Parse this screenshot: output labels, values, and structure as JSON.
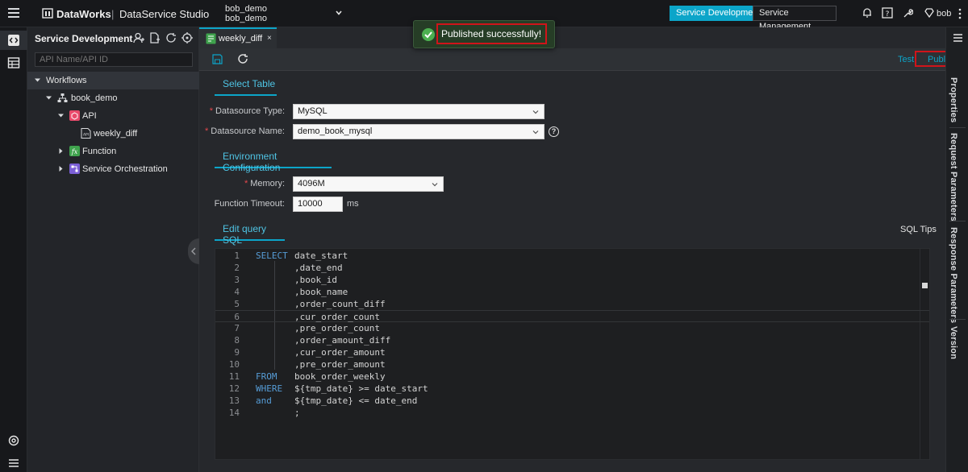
{
  "topbar": {
    "brand": "DataWorks",
    "separator": "|",
    "product": "DataService Studio",
    "workspace_line1": "bob_demo",
    "workspace_line2": "bob_demo",
    "mode_dev": "Service Development",
    "mode_mgmt": "Service Management",
    "user": "bob"
  },
  "toast": {
    "message": "Published successfully!",
    "status_color": "#4caf50"
  },
  "sidebar": {
    "title": "Service Development",
    "search_placeholder": "API Name/API ID",
    "tree": {
      "root": "Workflows",
      "project": "book_demo",
      "api_folder": "API",
      "api_item": "weekly_diff",
      "function_folder": "Function",
      "orchestration_folder": "Service Orchestration"
    }
  },
  "tab": {
    "label": "weekly_diff",
    "close": "×"
  },
  "toolbar": {
    "test": "Test",
    "publish": "Publish"
  },
  "select_table": {
    "title": "Select Table",
    "datasource_type_label": "Datasource Type:",
    "datasource_type_value": "MySQL",
    "datasource_name_label": "Datasource Name:",
    "datasource_name_value": "demo_book_mysql",
    "required_mark": "*",
    "help_glyph": "?"
  },
  "environment": {
    "title": "Environment Configuration",
    "memory_label": "Memory:",
    "memory_value": "4096M",
    "timeout_label": "Function Timeout:",
    "timeout_value": "10000",
    "timeout_unit": "ms"
  },
  "sql": {
    "title": "Edit query SQL",
    "tips": "SQL Tips",
    "lines": [
      {
        "n": "1",
        "kw": "SELECT",
        "code": "date_start"
      },
      {
        "n": "2",
        "kw": "",
        "code": ",date_end"
      },
      {
        "n": "3",
        "kw": "",
        "code": ",book_id"
      },
      {
        "n": "4",
        "kw": "",
        "code": ",book_name"
      },
      {
        "n": "5",
        "kw": "",
        "code": ",order_count_diff"
      },
      {
        "n": "6",
        "kw": "",
        "code": ",cur_order_count"
      },
      {
        "n": "7",
        "kw": "",
        "code": ",pre_order_count"
      },
      {
        "n": "8",
        "kw": "",
        "code": ",order_amount_diff"
      },
      {
        "n": "9",
        "kw": "",
        "code": ",cur_order_amount"
      },
      {
        "n": "10",
        "kw": "",
        "code": ",pre_order_amount"
      },
      {
        "n": "11",
        "kw": "FROM",
        "code": "book_order_weekly"
      },
      {
        "n": "12",
        "kw": "WHERE",
        "code": "${tmp_date} >= date_start"
      },
      {
        "n": "13",
        "kw": "and",
        "code": "${tmp_date} <= date_end"
      },
      {
        "n": "14",
        "kw": "",
        "code": ";"
      }
    ]
  },
  "right_panel": {
    "properties": "Properties",
    "request_params": "Request Parameters",
    "response_params": "Response Parameters",
    "version": "Version"
  },
  "colors": {
    "accent": "#0ca5c9",
    "highlight_box": "#d0141a",
    "keyword": "#569cd6"
  }
}
